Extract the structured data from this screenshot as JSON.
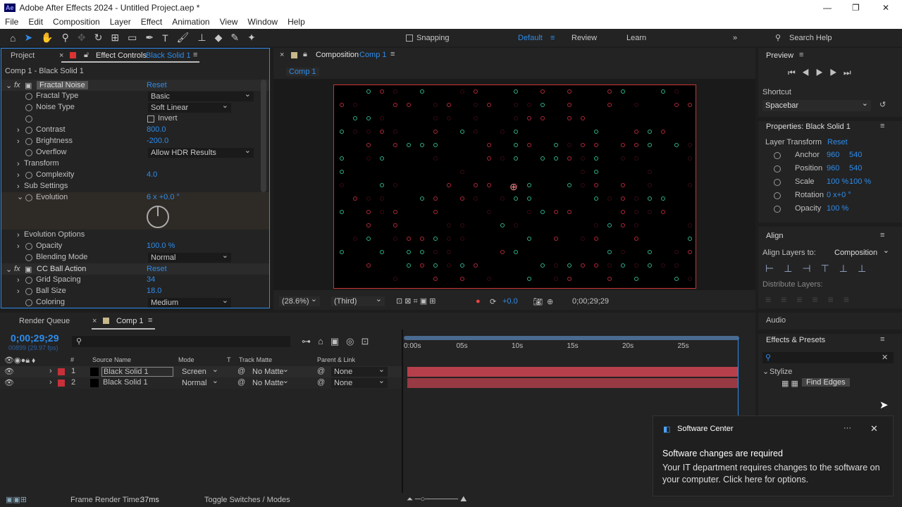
{
  "window": {
    "title": "Adobe After Effects 2024 - Untitled Project.aep *",
    "app_icon": "Ae"
  },
  "menu": [
    "File",
    "Edit",
    "Composition",
    "Layer",
    "Effect",
    "Animation",
    "View",
    "Window",
    "Help"
  ],
  "toolbar": {
    "snapping": "Snapping",
    "workspaces": [
      "Default",
      "Review",
      "Learn"
    ],
    "search": "Search Help"
  },
  "left_panel": {
    "tabs": [
      "Project",
      "Effect Controls"
    ],
    "active_layer": "Black Solid 1",
    "header": "Comp 1 - Black Solid 1",
    "effects": [
      {
        "name": "Fractal Noise",
        "reset": "Reset",
        "props": [
          {
            "label": "Fractal Type",
            "dropdown": "Basic"
          },
          {
            "label": "Noise Type",
            "dropdown": "Soft Linear"
          },
          {
            "label": "",
            "checkbox": "Invert"
          },
          {
            "label": "Contrast",
            "value": "800.0"
          },
          {
            "label": "Brightness",
            "value": "-200.0"
          },
          {
            "label": "Overflow",
            "dropdown": "Allow HDR Results"
          },
          {
            "label": "Transform"
          },
          {
            "label": "Complexity",
            "value": "4.0"
          },
          {
            "label": "Sub Settings"
          },
          {
            "label": "Evolution",
            "value": "6 x +0.0 °"
          },
          {
            "label": "Evolution Options"
          },
          {
            "label": "Opacity",
            "value": "100.0 %"
          },
          {
            "label": "Blending Mode",
            "dropdown": "Normal"
          }
        ]
      },
      {
        "name": "CC Ball Action",
        "reset": "Reset",
        "props": [
          {
            "label": "Grid Spacing",
            "value": "34"
          },
          {
            "label": "Ball Size",
            "value": "18.0"
          },
          {
            "label": "Coloring",
            "dropdown": "Medium"
          }
        ]
      }
    ]
  },
  "comp_panel": {
    "tab": "Composition",
    "comp": "Comp 1",
    "breadcrumb": "Comp 1",
    "zoom": "(28.6%)",
    "view": "(Third)",
    "exposure": "+0.0",
    "timecode": "0;00;29;29"
  },
  "right_panel": {
    "preview": "Preview",
    "shortcut_label": "Shortcut",
    "shortcut": "Spacebar",
    "properties_title": "Properties: Black Solid 1",
    "layer_transform": "Layer Transform",
    "reset": "Reset",
    "transform": [
      {
        "label": "Anchor",
        "v1": "960",
        "v2": "540"
      },
      {
        "label": "Position",
        "v1": "960",
        "v2": "540"
      },
      {
        "label": "Scale",
        "v1": "100 %",
        "v2": "100 %"
      },
      {
        "label": "Rotation",
        "v1": "0 x+0 °",
        "v2": ""
      },
      {
        "label": "Opacity",
        "v1": "100 %",
        "v2": ""
      }
    ],
    "align": "Align",
    "align_to_label": "Align Layers to:",
    "align_to": "Composition",
    "distribute": "Distribute Layers:",
    "audio": "Audio",
    "effects_presets": "Effects & Presets",
    "search_value": "",
    "category": "Stylize",
    "effect_item": "Find Edges"
  },
  "timeline": {
    "tabs": [
      "Render Queue",
      "Comp 1"
    ],
    "timecode": "0;00;29;29",
    "frame": "00899 (29.97 fps)",
    "columns": {
      "num": "#",
      "source": "Source Name",
      "mode": "Mode",
      "t": "T",
      "matte": "Track Matte",
      "parent": "Parent & Link"
    },
    "ruler": [
      "0:00s",
      "05s",
      "10s",
      "15s",
      "20s",
      "25s"
    ],
    "layers": [
      {
        "num": "1",
        "name": "Black Solid 1",
        "mode": "Screen",
        "matte": "No Matte",
        "parent": "None",
        "color": "#c8303a"
      },
      {
        "num": "2",
        "name": "Black Solid 1",
        "mode": "Normal",
        "matte": "No Matte",
        "parent": "None",
        "color": "#c8303a"
      }
    ],
    "playhead_fraction": 1.0
  },
  "status": {
    "render_time_label": "Frame Render Time:",
    "render_time": "37ms",
    "toggle": "Toggle Switches / Modes"
  },
  "notification": {
    "app": "Software Center",
    "title": "Software changes are required",
    "body": "Your IT department requires changes to the software on your computer. Click here for options.",
    "more": "···"
  },
  "colors": {
    "accent": "#2d8ceb",
    "layer_label": "#c8303a",
    "track_bar": "#b5404c"
  }
}
